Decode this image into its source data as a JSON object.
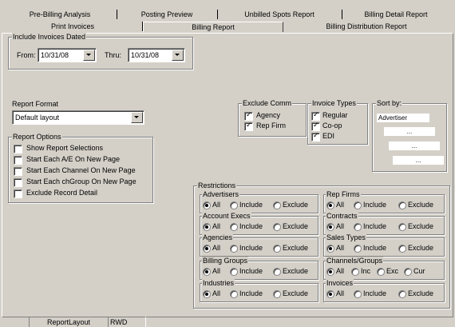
{
  "tabs_row1": [
    "Pre-Billing Analysis",
    "Posting Preview",
    "Unbilled Spots Report",
    "Billing Detail Report"
  ],
  "tabs_row2": [
    "Print Invoices",
    "Billing Report",
    "Billing Distribution Report"
  ],
  "include_invoices": {
    "label": "Include Invoices Dated",
    "from_label": "From:",
    "from_value": "10/31/08",
    "thru_label": "Thru:",
    "thru_value": "10/31/08"
  },
  "report_format": {
    "label": "Report Format",
    "value": "Default layout"
  },
  "report_options": {
    "label": "Report Options",
    "items": [
      {
        "label": "Show Report Selections",
        "checked": false
      },
      {
        "label": "Start Each A/E On New Page",
        "checked": false
      },
      {
        "label": "Start Each Channel On New Page",
        "checked": false
      },
      {
        "label": "Start Each chGroup On New Page",
        "checked": false
      },
      {
        "label": "Exclude Record Detail",
        "checked": false
      }
    ]
  },
  "exclude_comm": {
    "label": "Exclude Comm",
    "items": [
      {
        "label": "Agency",
        "checked": true
      },
      {
        "label": "Rep Firm",
        "checked": true
      }
    ]
  },
  "invoice_types": {
    "label": "Invoice Types",
    "items": [
      {
        "label": "Regular",
        "checked": true
      },
      {
        "label": "Co-op",
        "checked": true
      },
      {
        "label": "EDI",
        "checked": true
      }
    ]
  },
  "sort_by": {
    "label": "Sort by:",
    "items": [
      "Advertiser",
      "...",
      "...",
      "..."
    ]
  },
  "restrictions": {
    "label": "Restrictions",
    "groups": [
      {
        "label": "Advertisers",
        "options": [
          "All",
          "Include",
          "Exclude"
        ],
        "selected": 0
      },
      {
        "label": "Rep Firms",
        "options": [
          "All",
          "Include",
          "Exclude"
        ],
        "selected": 0
      },
      {
        "label": "Account Execs",
        "options": [
          "All",
          "Include",
          "Exclude"
        ],
        "selected": 0
      },
      {
        "label": "Contracts",
        "options": [
          "All",
          "Include",
          "Exclude"
        ],
        "selected": 0
      },
      {
        "label": "Agencies",
        "options": [
          "All",
          "Include",
          "Exclude"
        ],
        "selected": 0
      },
      {
        "label": "Sales Types",
        "options": [
          "All",
          "Include",
          "Exclude"
        ],
        "selected": 0
      },
      {
        "label": "Billing Groups",
        "options": [
          "All",
          "Include",
          "Exclude"
        ],
        "selected": 0
      },
      {
        "label": "Channels/Groups",
        "options": [
          "All",
          "Inc",
          "Exc",
          "Cur"
        ],
        "selected": 0
      },
      {
        "label": "Industries",
        "options": [
          "All",
          "Include",
          "Exclude"
        ],
        "selected": 0
      },
      {
        "label": "Invoices",
        "options": [
          "All",
          "Include",
          "Exclude"
        ],
        "selected": 0
      }
    ]
  },
  "status_bar": [
    "ReportLayout",
    "RWD"
  ]
}
